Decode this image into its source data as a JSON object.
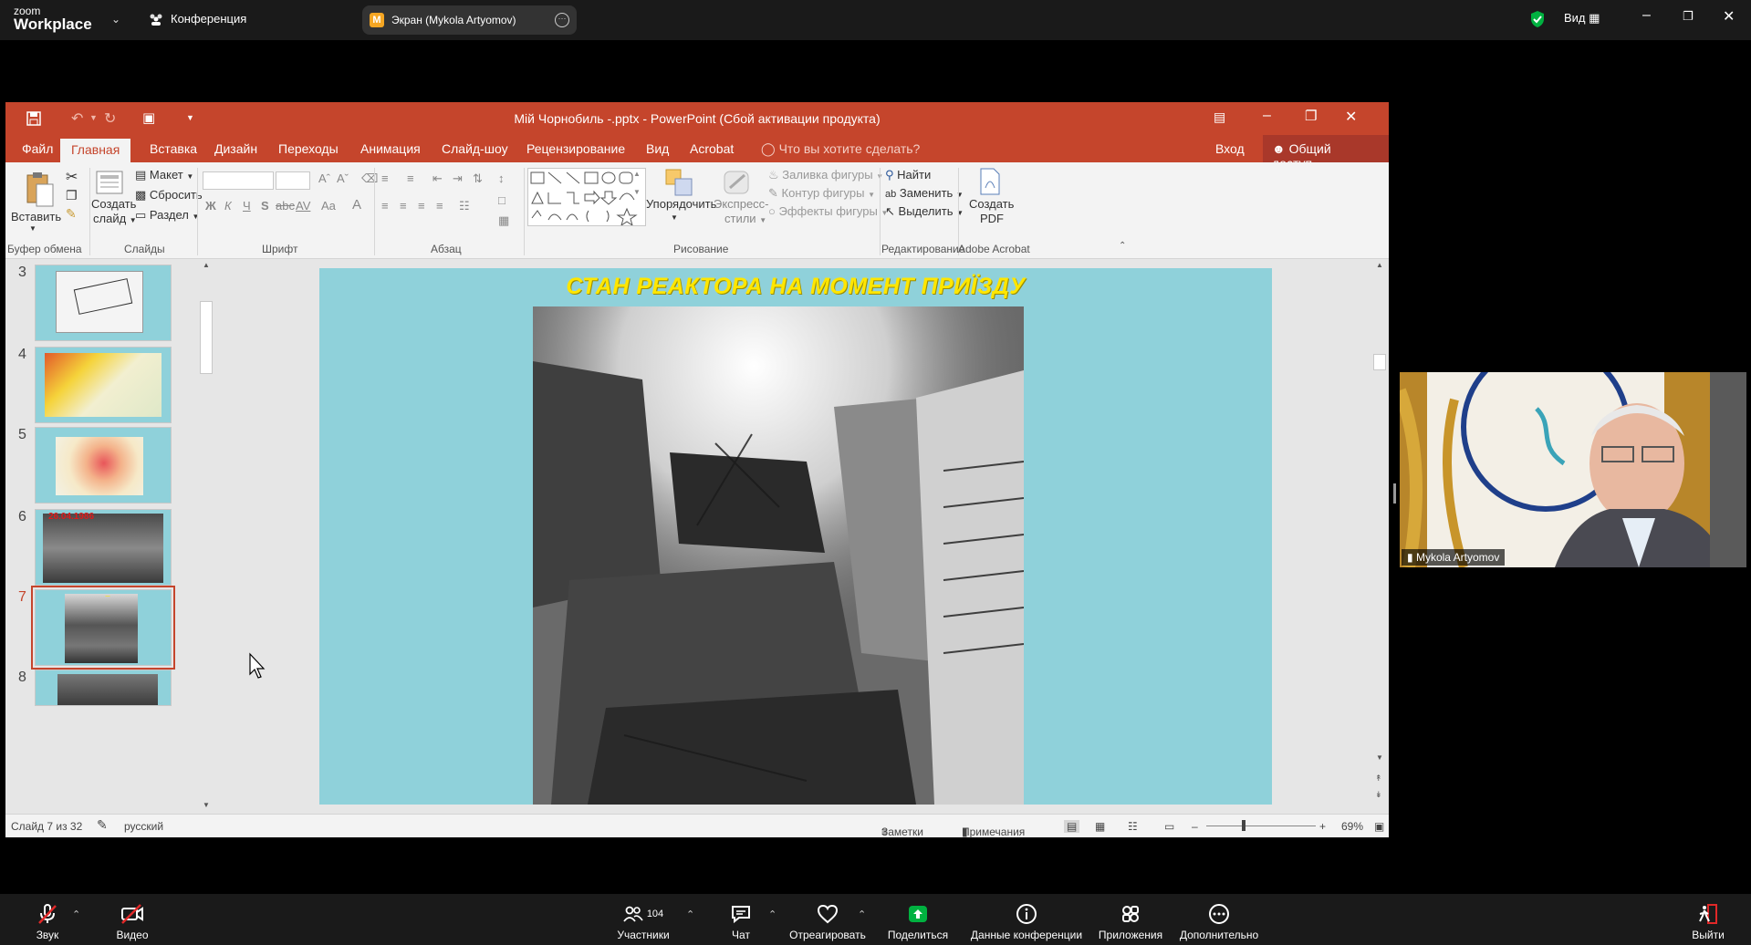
{
  "zoom": {
    "logo_small": "zoom",
    "logo_big": "Workplace",
    "conference_label": "Конференция",
    "share_badge": "M",
    "share_label": "Экран (Mykola Artyomov)",
    "view_label": "Вид",
    "bottom": {
      "audio": "Звук",
      "video": "Видео",
      "participants": "Участники",
      "participants_count": "104",
      "chat": "Чат",
      "react": "Отреагировать",
      "share": "Поделиться",
      "info": "Данные конференции",
      "apps": "Приложения",
      "more": "Дополнительно",
      "leave": "Выйти"
    },
    "video_tile_name": "Mykola Artyomov",
    "accent_green": "#00b140",
    "leave_red": "#e02828"
  },
  "ppt": {
    "title": "Мій Чорнобиль -.pptx - PowerPoint (Сбой активации продукта)",
    "accent": "#c5452c",
    "tabs": [
      "Файл",
      "Главная",
      "Вставка",
      "Дизайн",
      "Переходы",
      "Анимация",
      "Слайд-шоу",
      "Рецензирование",
      "Вид",
      "Acrobat"
    ],
    "tell_me": "Что вы хотите сделать?",
    "signin": "Вход",
    "share": "Общий доступ",
    "ribbon": {
      "paste": "Вставить",
      "new_slide_1": "Создать",
      "new_slide_2": "слайд",
      "layout": "Макет",
      "reset": "Сбросить",
      "section": "Раздел",
      "font_bold": "Ж",
      "font_italic": "К",
      "font_underline": "Ч",
      "font_strike": "S",
      "font_abc": "abc",
      "font_av": "AV",
      "font_aa": "Aa",
      "font_a": "A",
      "arrange": "Упорядочить",
      "quick_styles_1": "Экспресс-",
      "quick_styles_2": "стили",
      "shape_fill": "Заливка фигуры",
      "shape_outline": "Контур фигуры",
      "shape_effects": "Эффекты фигуры",
      "find": "Найти",
      "replace": "Заменить",
      "select": "Выделить",
      "create_pdf_1": "Создать",
      "create_pdf_2": "PDF",
      "groups": [
        "Буфер обмена",
        "Слайды",
        "Шрифт",
        "Абзац",
        "Рисование",
        "Редактирование",
        "Adobe Acrobat"
      ]
    },
    "thumbnails": [
      {
        "num": "3"
      },
      {
        "num": "4"
      },
      {
        "num": "5"
      },
      {
        "num": "6",
        "caption": "26.04.1986"
      },
      {
        "num": "7",
        "selected": true
      },
      {
        "num": "8"
      }
    ],
    "slide_title": "СТАН РЕАКТОРА НА МОМЕНТ ПРИЇЗДУ",
    "status": {
      "slide_of": "Слайд 7 из 32",
      "language": "русский",
      "notes": "Заметки",
      "comments": "Примечания",
      "zoom": "69%",
      "zoom_fraction": 0.69
    }
  }
}
